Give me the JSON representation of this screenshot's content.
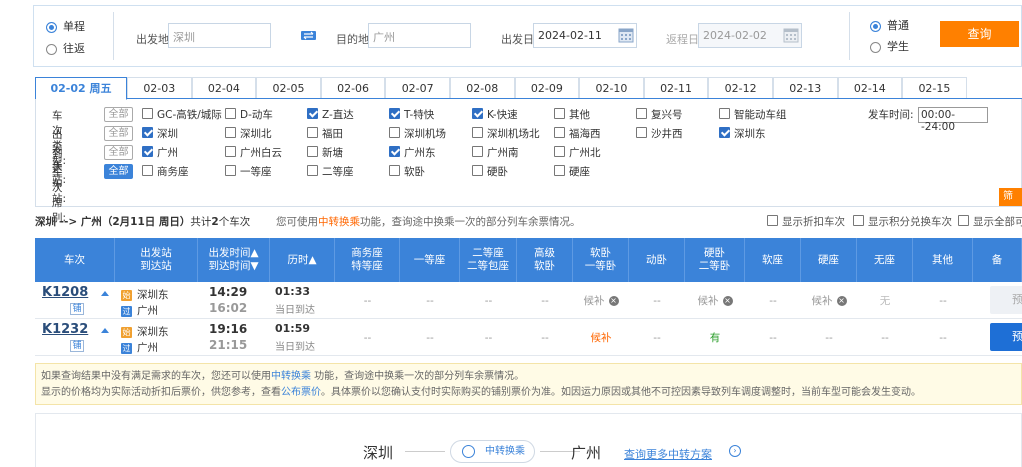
{
  "search": {
    "trip_oneway": "单程",
    "trip_round": "往返",
    "from_label": "出发地",
    "from_value": "深圳",
    "swap_icon": "swap-icon",
    "to_label": "目的地",
    "to_value": "广州",
    "depart_label": "出发日",
    "depart_value": "2024-02-11",
    "return_label": "返程日",
    "return_value": "2024-02-02",
    "type_normal": "普通",
    "type_student": "学生",
    "query_label": "查询"
  },
  "date_tabs": [
    {
      "label": "02-02 周五",
      "active": true
    },
    {
      "label": "02-03"
    },
    {
      "label": "02-04"
    },
    {
      "label": "02-05"
    },
    {
      "label": "02-06"
    },
    {
      "label": "02-07"
    },
    {
      "label": "02-08"
    },
    {
      "label": "02-09"
    },
    {
      "label": "02-10"
    },
    {
      "label": "02-11"
    },
    {
      "label": "02-12"
    },
    {
      "label": "02-13"
    },
    {
      "label": "02-14"
    },
    {
      "label": "02-15"
    }
  ],
  "filters": {
    "all_label": "全部",
    "type_title": "车次类型:",
    "types": [
      {
        "label": "GC-高铁/城际",
        "checked": false
      },
      {
        "label": "D-动车",
        "checked": false
      },
      {
        "label": "Z-直达",
        "checked": true
      },
      {
        "label": "T-特快",
        "checked": true
      },
      {
        "label": "K-快速",
        "checked": true
      },
      {
        "label": "其他",
        "checked": false
      },
      {
        "label": "复兴号",
        "checked": false
      },
      {
        "label": "智能动车组",
        "checked": false
      }
    ],
    "depart_time_label": "发车时间:",
    "depart_time_value": "00:00--24:00",
    "from_title": "出发车站:",
    "from_stations": [
      {
        "label": "深圳",
        "checked": true
      },
      {
        "label": "深圳北",
        "checked": false
      },
      {
        "label": "福田",
        "checked": false
      },
      {
        "label": "深圳机场",
        "checked": false
      },
      {
        "label": "深圳机场北",
        "checked": false
      },
      {
        "label": "福海西",
        "checked": false
      },
      {
        "label": "沙井西",
        "checked": false
      },
      {
        "label": "深圳东",
        "checked": true
      }
    ],
    "to_title": "到达车站:",
    "to_stations": [
      {
        "label": "广州",
        "checked": true
      },
      {
        "label": "广州白云",
        "checked": false
      },
      {
        "label": "新塘",
        "checked": false
      },
      {
        "label": "广州东",
        "checked": true
      },
      {
        "label": "广州南",
        "checked": false
      },
      {
        "label": "广州北",
        "checked": false
      }
    ],
    "seat_title": "车次席别:",
    "seats": [
      {
        "label": "商务座",
        "checked": false
      },
      {
        "label": "一等座",
        "checked": false
      },
      {
        "label": "二等座",
        "checked": false
      },
      {
        "label": "软卧",
        "checked": false
      },
      {
        "label": "硬卧",
        "checked": false
      },
      {
        "label": "硬座",
        "checked": false
      }
    ],
    "filter_btn": "筛选"
  },
  "summary": {
    "route": "深圳 --> 广州",
    "date": "（2月11日 周日）",
    "count_pre": "共计",
    "count": "2",
    "count_post": "个车次",
    "hint_pre": "您可使用",
    "hint_link": "中转换乘",
    "hint_post": "功能，查询途中换乘一次的部分列车余票情况。",
    "check_discount": "显示折扣车次",
    "check_points": "显示积分兑换车次",
    "check_all": "显示全部可"
  },
  "table": {
    "headers": [
      {
        "l1": "车次",
        "l2": ""
      },
      {
        "l1": "出发站",
        "l2": "到达站"
      },
      {
        "l1": "出发时间▲",
        "l2": "到达时间▼"
      },
      {
        "l1": "历时▲",
        "l2": ""
      },
      {
        "l1": "商务座",
        "l2": "特等座"
      },
      {
        "l1": "一等座",
        "l2": ""
      },
      {
        "l1": "二等座",
        "l2": "二等包座"
      },
      {
        "l1": "高级",
        "l2": "软卧"
      },
      {
        "l1": "软卧",
        "l2": "一等卧"
      },
      {
        "l1": "动卧",
        "l2": ""
      },
      {
        "l1": "硬卧",
        "l2": "二等卧"
      },
      {
        "l1": "软座",
        "l2": ""
      },
      {
        "l1": "硬座",
        "l2": ""
      },
      {
        "l1": "无座",
        "l2": ""
      },
      {
        "l1": "其他",
        "l2": ""
      },
      {
        "l1": "备",
        "l2": ""
      }
    ],
    "rows": [
      {
        "train": "K1208",
        "pu": "铺",
        "from_icon": "始",
        "from": "深圳东",
        "to_icon": "过",
        "to": "广州",
        "depart": "14:29",
        "arrive": "16:02",
        "duration": "01:33",
        "duration_note": "当日到达",
        "seats": [
          "--",
          "--",
          "--",
          "--",
          "候补",
          "--",
          "候补",
          "--",
          "候补",
          "无",
          "--"
        ],
        "book": "预"
      },
      {
        "train": "K1232",
        "pu": "铺",
        "from_icon": "始",
        "from": "深圳东",
        "to_icon": "过",
        "to": "广州",
        "depart": "19:16",
        "arrive": "21:15",
        "duration": "01:59",
        "duration_note": "当日到达",
        "seats": [
          "--",
          "--",
          "--",
          "--",
          "候补",
          "--",
          "有",
          "--",
          "--",
          "--",
          "--"
        ],
        "book": "预"
      }
    ]
  },
  "notice": {
    "line1_pre": "如果查询结果中没有满足需求的车次，您还可以使用",
    "line1_link": "中转换乘",
    "line1_post": " 功能，查询途中换乘一次的部分列车余票情况。",
    "line2_pre": "显示的价格均为实际活动折扣后票价，供您参考，查看",
    "line2_link": "公布票价",
    "line2_post": "。具体票价以您确认支付时实际购买的铺别票价为准。如因运力原因或其他不可控因素导致列车调度调整时，当前车型可能会发生变动。"
  },
  "transfer": {
    "from": "深圳",
    "to": "广州",
    "pill": "中转换乘",
    "more": "查询更多中转方案"
  },
  "colors": {
    "accent": "#3b83d9",
    "orange": "#ff8000",
    "candidate": "#ff6600",
    "available": "#2a9d2a"
  }
}
